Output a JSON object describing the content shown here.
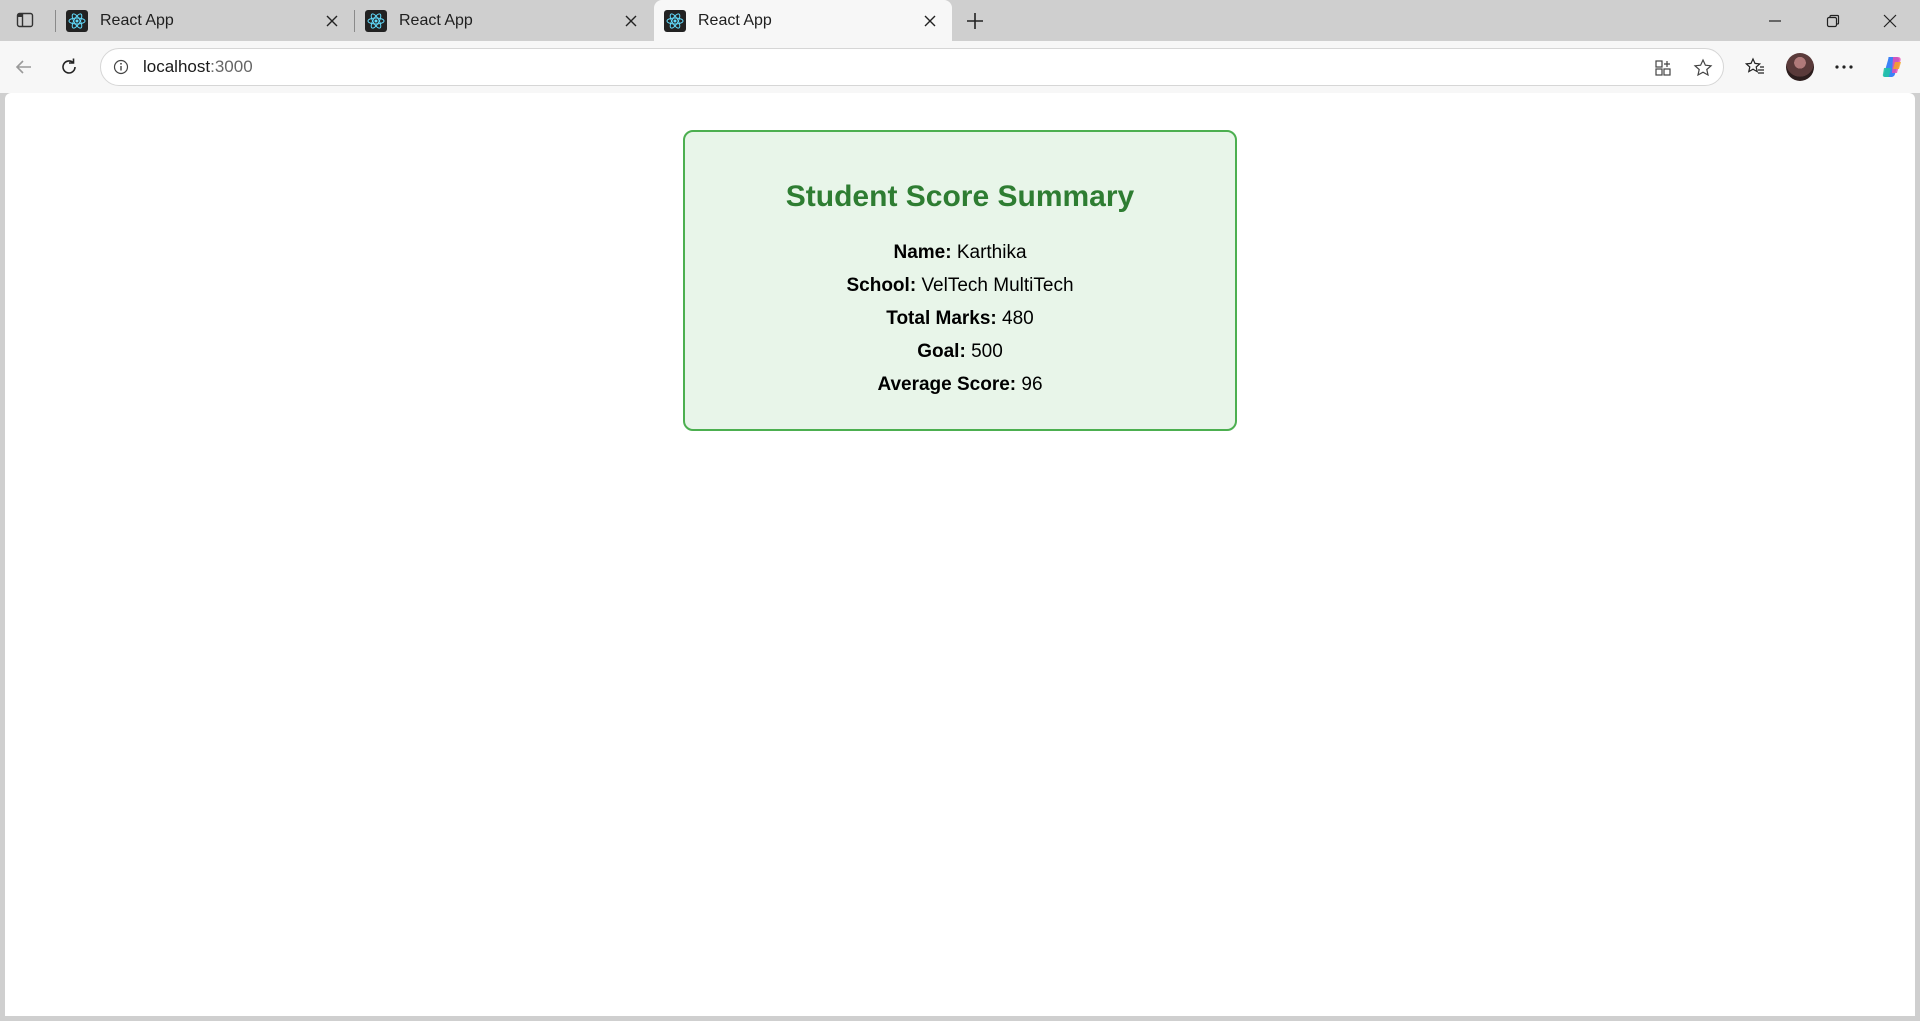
{
  "browser": {
    "tabs": [
      {
        "title": "React App",
        "active": false
      },
      {
        "title": "React App",
        "active": false
      },
      {
        "title": "React App",
        "active": true
      }
    ],
    "address": {
      "host": "localhost",
      "port": ":3000"
    }
  },
  "summary": {
    "title": "Student Score Summary",
    "fields": [
      {
        "label": "Name:",
        "value": "Karthika"
      },
      {
        "label": "School:",
        "value": "VelTech MultiTech"
      },
      {
        "label": "Total Marks:",
        "value": "480"
      },
      {
        "label": "Goal:",
        "value": "500"
      },
      {
        "label": "Average Score:",
        "value": "96"
      }
    ]
  },
  "colors": {
    "accent": "#2e7d32",
    "card_border": "#4caf50",
    "card_bg": "#e8f5e9"
  }
}
